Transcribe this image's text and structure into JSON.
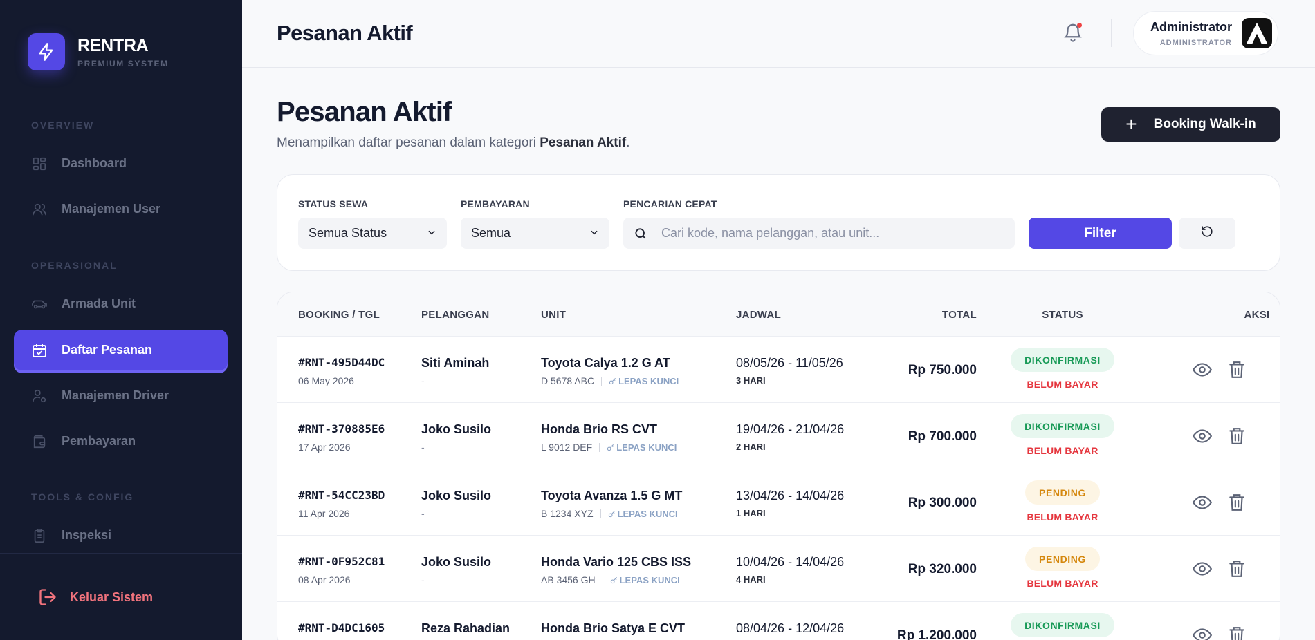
{
  "brand": {
    "name": "RENTRA",
    "subtitle": "PREMIUM SYSTEM"
  },
  "sidebar": {
    "sections": [
      "OVERVIEW",
      "OPERASIONAL",
      "TOOLS & CONFIG"
    ],
    "items": [
      {
        "label": "Dashboard",
        "icon": "grid-icon"
      },
      {
        "label": "Manajemen User",
        "icon": "users-icon"
      },
      {
        "label": "Armada Unit",
        "icon": "car-icon"
      },
      {
        "label": "Daftar Pesanan",
        "icon": "calendar-check-icon",
        "active": true
      },
      {
        "label": "Manajemen Driver",
        "icon": "user-cog-icon"
      },
      {
        "label": "Pembayaran",
        "icon": "wallet-icon"
      },
      {
        "label": "Inspeksi",
        "icon": "clipboard-icon"
      }
    ],
    "logout": "Keluar Sistem"
  },
  "topbar": {
    "title": "Pesanan Aktif",
    "user": {
      "name": "Administrator",
      "role": "ADMINISTRATOR"
    }
  },
  "page": {
    "title": "Pesanan Aktif",
    "desc_prefix": "Menampilkan daftar pesanan dalam kategori ",
    "desc_bold": "Pesanan Aktif",
    "desc_suffix": ".",
    "walkin_label": "Booking Walk-in"
  },
  "filters": {
    "status_label": "STATUS SEWA",
    "status_value": "Semua Status",
    "payment_label": "PEMBAYARAN",
    "payment_value": "Semua",
    "search_label": "PENCARIAN CEPAT",
    "search_placeholder": "Cari kode, nama pelanggan, atau unit...",
    "filter_button": "Filter"
  },
  "table": {
    "headers": [
      "BOOKING / TGL",
      "PELANGGAN",
      "UNIT",
      "JADWAL",
      "TOTAL",
      "STATUS",
      "AKSI"
    ],
    "rows": [
      {
        "code": "#RNT-495D44DC",
        "date": "06 May 2026",
        "customer": "Siti Aminah",
        "customer_sub": "-",
        "unit": "Toyota Calya 1.2 G AT",
        "plate": "D 5678 ABC",
        "key": "LEPAS KUNCI",
        "schedule": "08/05/26 - 11/05/26",
        "days": "3 HARI",
        "total": "Rp 750.000",
        "status": "DIKONFIRMASI",
        "status_kind": "ok",
        "payment": "BELUM BAYAR"
      },
      {
        "code": "#RNT-370885E6",
        "date": "17 Apr 2026",
        "customer": "Joko Susilo",
        "customer_sub": "-",
        "unit": "Honda Brio RS CVT",
        "plate": "L 9012 DEF",
        "key": "LEPAS KUNCI",
        "schedule": "19/04/26 - 21/04/26",
        "days": "2 HARI",
        "total": "Rp 700.000",
        "status": "DIKONFIRMASI",
        "status_kind": "ok",
        "payment": "BELUM BAYAR"
      },
      {
        "code": "#RNT-54CC23BD",
        "date": "11 Apr 2026",
        "customer": "Joko Susilo",
        "customer_sub": "-",
        "unit": "Toyota Avanza 1.5 G MT",
        "plate": "B 1234 XYZ",
        "key": "LEPAS KUNCI",
        "schedule": "13/04/26 - 14/04/26",
        "days": "1 HARI",
        "total": "Rp 300.000",
        "status": "PENDING",
        "status_kind": "pend",
        "payment": "BELUM BAYAR"
      },
      {
        "code": "#RNT-0F952C81",
        "date": "08 Apr 2026",
        "customer": "Joko Susilo",
        "customer_sub": "-",
        "unit": "Honda Vario 125 CBS ISS",
        "plate": "AB 3456 GH",
        "key": "LEPAS KUNCI",
        "schedule": "10/04/26 - 14/04/26",
        "days": "4 HARI",
        "total": "Rp 320.000",
        "status": "PENDING",
        "status_kind": "pend",
        "payment": "BELUM BAYAR"
      },
      {
        "code": "#RNT-D4DC1605",
        "date": "",
        "customer": "Reza Rahadian",
        "customer_sub": "",
        "unit": "Honda Brio Satya E CVT",
        "plate": "",
        "key": "",
        "schedule": "08/04/26 - 12/04/26",
        "days": "",
        "total": "Rp 1.200.000",
        "status": "DIKONFIRMASI",
        "status_kind": "ok",
        "payment": ""
      }
    ]
  }
}
